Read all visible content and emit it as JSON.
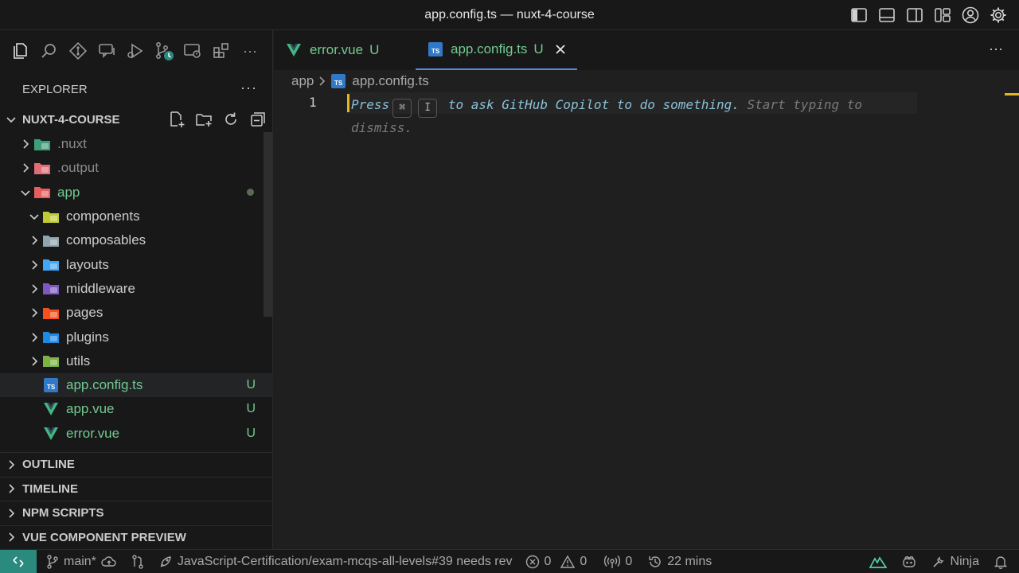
{
  "window": {
    "title": "app.config.ts — nuxt-4-course"
  },
  "explorer": {
    "heading": "EXPLORER",
    "project": "NUXT-4-COURSE",
    "tree": [
      {
        "label": ".nuxt",
        "kind": "folder",
        "open": false,
        "depth": 0,
        "dim": true
      },
      {
        "label": ".output",
        "kind": "folder",
        "open": false,
        "depth": 0,
        "dim": true
      },
      {
        "label": "app",
        "kind": "folder",
        "open": true,
        "depth": 0,
        "modified_dot": true
      },
      {
        "label": "components",
        "kind": "folder",
        "open": true,
        "depth": 1
      },
      {
        "label": "composables",
        "kind": "folder",
        "open": false,
        "depth": 1
      },
      {
        "label": "layouts",
        "kind": "folder",
        "open": false,
        "depth": 1
      },
      {
        "label": "middleware",
        "kind": "folder",
        "open": false,
        "depth": 1
      },
      {
        "label": "pages",
        "kind": "folder",
        "open": false,
        "depth": 1
      },
      {
        "label": "plugins",
        "kind": "folder",
        "open": false,
        "depth": 1
      },
      {
        "label": "utils",
        "kind": "folder",
        "open": false,
        "depth": 1
      },
      {
        "label": "app.config.ts",
        "kind": "ts",
        "depth": 1,
        "status": "U",
        "selected": true
      },
      {
        "label": "app.vue",
        "kind": "vue",
        "depth": 1,
        "status": "U"
      },
      {
        "label": "error.vue",
        "kind": "vue",
        "depth": 1,
        "status": "U"
      }
    ],
    "sections": [
      "OUTLINE",
      "TIMELINE",
      "NPM SCRIPTS",
      "VUE COMPONENT PREVIEW"
    ]
  },
  "tabs": [
    {
      "label": "error.vue",
      "status": "U",
      "kind": "vue"
    },
    {
      "label": "app.config.ts",
      "status": "U",
      "kind": "ts",
      "active": true
    }
  ],
  "breadcrumb": {
    "folder": "app",
    "file": "app.config.ts"
  },
  "editor": {
    "line_number": "1",
    "hint_press": "Press",
    "kbd_cmd": "⌘",
    "kbd_i": "I",
    "hint_main": "to ask GitHub Copilot to do something.",
    "hint_rest1": "Start typing to",
    "hint_rest2": "dismiss."
  },
  "statusbar": {
    "branch": "main*",
    "pr": "JavaScript-Certification/exam-mcqs-all-levels#39 needs rev",
    "errors": "0",
    "warnings": "0",
    "ports": "0",
    "time": "22 mins",
    "ninja": "Ninja"
  },
  "colors": {
    "accent": "#4f8fd6",
    "untracked": "#73c991",
    "remote": "#2a8a7e",
    "cursor": "#e6b422"
  }
}
